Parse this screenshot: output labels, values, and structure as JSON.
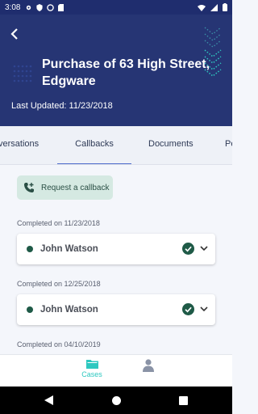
{
  "status_bar": {
    "time": "3:08"
  },
  "header": {
    "title": "Purchase of 63 High Street, Edgware",
    "last_updated": "Last Updated: 11/23/2018"
  },
  "tabs": [
    {
      "label": "Conversations",
      "visible_text": "versations"
    },
    {
      "label": "Callbacks",
      "visible_text": "Callbacks",
      "active": true
    },
    {
      "label": "Documents",
      "visible_text": "Documents"
    },
    {
      "label": "People",
      "visible_text": "Pe"
    }
  ],
  "callback_button": {
    "label": "Request a callback"
  },
  "callbacks": [
    {
      "completed_label": "Completed on 11/23/2018",
      "name": "John Watson"
    },
    {
      "completed_label": "Completed on 12/25/2018",
      "name": "John Watson"
    },
    {
      "completed_label": "Completed on 04/10/2019"
    }
  ],
  "bottom_nav": {
    "cases_label": "Cases"
  },
  "colors": {
    "header_bg": "#263574",
    "accent_teal": "#2ec8c0",
    "status_green": "#1f5a47",
    "tab_indicator": "#4e6bcc"
  }
}
